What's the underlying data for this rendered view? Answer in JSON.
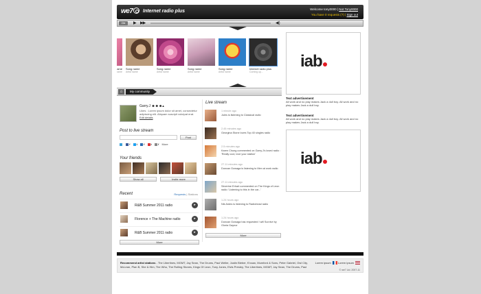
{
  "header": {
    "logo": "we7",
    "app_title": "Internet radio plus",
    "welcome_prefix": "Welcome tony0000 |",
    "not_user": "Not Tony0000",
    "requests": "You have 0 requests (?) |",
    "sign_out": "Sign out"
  },
  "player": {
    "menu_icon": "radio-menu-icon",
    "play_icon": "play-icon",
    "ff_icon": "fast-forward-icon",
    "volume_icon": "volume-icon"
  },
  "carousel": [
    {
      "name": "Song name",
      "artist": "Artist name",
      "art": "cover-pink"
    },
    {
      "name": "Song name",
      "artist": "Artist name",
      "art": "cover-girl"
    },
    {
      "name": "Song name",
      "artist": "Artist name",
      "art": "cover-magenta"
    },
    {
      "name": "Song name",
      "artist": "Artist name",
      "art": "cover-woman"
    },
    {
      "name": "Song name",
      "artist": "Artist name",
      "art": "cover-sun"
    },
    {
      "name": "Internet radio plus",
      "artist": "Coming up...",
      "art": "cover-radio"
    }
  ],
  "carousel_partial": {
    "name": "name",
    "artist": "name"
  },
  "section": {
    "tab": "My community"
  },
  "profile": {
    "name": "Garry.J",
    "likes": "Likes : Lorem ipsum dolor sit amet, consectetur adipiscing elit. Aliquam suscipit volutpat erat.",
    "edit": "Edit details"
  },
  "post": {
    "heading": "Post to live stream",
    "button": "Post",
    "share": [
      "f",
      "t",
      "f",
      "t",
      "f",
      "More"
    ]
  },
  "friends": {
    "heading": "Your friends",
    "show_all": "Show all",
    "invite": "Invite more"
  },
  "recent": {
    "heading": "Recent",
    "tab_requests": "Requests",
    "tab_sep": "|",
    "tab_stations": "Stations",
    "items": [
      "R&B Summer 2011 radio",
      "Florence + The Machine radio",
      "R&B Summer 2011 radio"
    ],
    "more": "More"
  },
  "live": {
    "heading": "Live stream",
    "items": [
      {
        "time": "1 minute ago",
        "text": "Jules is listening to Classical radio"
      },
      {
        "time": "2.45 minutes ago",
        "text": "Georgina Stone loves Top 40 singles radio"
      },
      {
        "time": "2.5 minutes ago",
        "text": "Karen Chung commented on Garry.J's loved radio : 'Really cool, love your station'"
      },
      {
        "time": "27.11 minutes ago",
        "text": "Duncan Gowaga is listening to Men at work radio"
      },
      {
        "time": "27.11 minutes ago",
        "text": "Séverine Erhart commented on The Kings of Leon radio: 'Listening to this in the car...'"
      },
      {
        "time": "1.24 hours ago",
        "text": "Nik Ardes is listening to Radiohead radio"
      },
      {
        "time": "1.24 hours ago",
        "text": "Duncan Gowaga has requested I will Survive by Gloria Gaynor"
      }
    ],
    "more": "More"
  },
  "ads": {
    "logo": "iab",
    "text_ads": [
      {
        "title": "Text advertisement",
        "body": "All work and no play makes Jack a dull boy. All work and no play makes Jack a dull boy."
      },
      {
        "title": "Text advertisement",
        "body": "All work and no play makes Jack a dull boy. All work and no play makes Jack a dull boy."
      }
    ]
  },
  "footer": {
    "label": "Recommend artist stations",
    "artists": " - The Libertines, MGMT, Jay Sean, The Drums, Paul Weller, Justin Bieber, K'naan, Mumford & Sons, Peter Gabriel, Owl City, McLean, Plan B, She & Him, The Who, The Rolling Stones, Kings Of Leon, Tony Jones, Elvis Presley, The Libertines, MGMT, Jay Sean, The Drums, Paul",
    "lang1": "Lorem ipsum",
    "lang2": "Lorem ipsum",
    "copyright": "© we7 Ltd. 2007-11"
  },
  "colors": {
    "accent_yellow": "#f2c300",
    "iab_red": "#e31b23",
    "dark": "#111111"
  }
}
